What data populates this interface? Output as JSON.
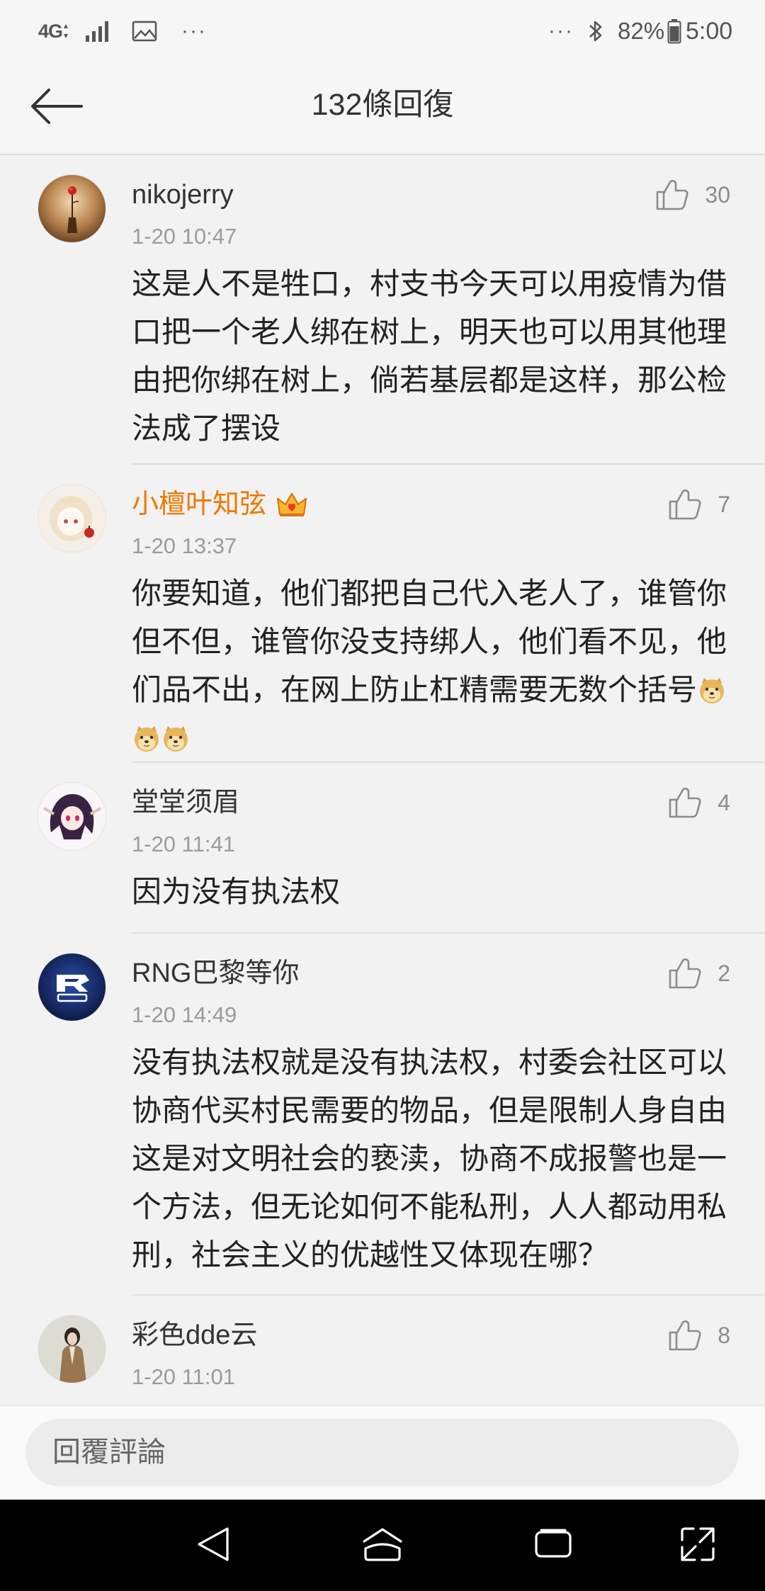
{
  "status_bar": {
    "network": "4G",
    "left_more": "···",
    "right_more": "···",
    "battery": "82%",
    "time": "5:00",
    "icons": [
      "network-arrows-icon",
      "signal-icon",
      "image-icon",
      "bluetooth-icon",
      "battery-icon"
    ]
  },
  "header": {
    "title": "132條回復",
    "back_icon": "back-arrow-icon"
  },
  "like_icon": "thumbs-up-icon",
  "comments": [
    {
      "username": "nikojerry",
      "time": "1-20 10:47",
      "likes": "30",
      "text": "这是人不是牲口，村支书今天可以用疫情为借口把一个老人绑在树上，明天也可以用其他理由把你绑在树上，倘若基层都是这样，那公检法成了摆设"
    },
    {
      "username": "小檀叶知弦",
      "username_color": "#f07800",
      "badge_icon": "vip-crown-icon",
      "time": "1-20 13:37",
      "likes": "7",
      "text": "你要知道，他们都把自己代入老人了，谁管你但不但，谁管你没支持绑人，他们看不见，他们品不出，在网上防止杠精需要无数个括号",
      "emojis": [
        "doge",
        "doge",
        "doge"
      ]
    },
    {
      "username": "堂堂须眉",
      "time": "1-20 11:41",
      "likes": "4",
      "text": "因为没有执法权"
    },
    {
      "username": "RNG巴黎等你",
      "time": "1-20 14:49",
      "likes": "2",
      "text": "没有执法权就是没有执法权，村委会社区可以协商代买村民需要的物品，但是限制人身自由这是对文明社会的亵渎，协商不成报警也是一个方法，但无论如何不能私刑，人人都动用私刑，社会主义的优越性又体现在哪？"
    },
    {
      "username": "彩色dde云",
      "time": "1-20 11:01",
      "likes": "8"
    }
  ],
  "reply_input": {
    "placeholder": "回覆評論"
  },
  "nav_bar": {
    "icons": [
      "nav-back-icon",
      "nav-home-icon",
      "recent-apps-icon",
      "rotate-screen-icon"
    ]
  },
  "colors": {
    "background": "#f2f2f2",
    "text_primary": "#333333",
    "text_secondary": "#9b9b9b",
    "vip_username": "#f07800",
    "nav_bar": "#000000"
  }
}
